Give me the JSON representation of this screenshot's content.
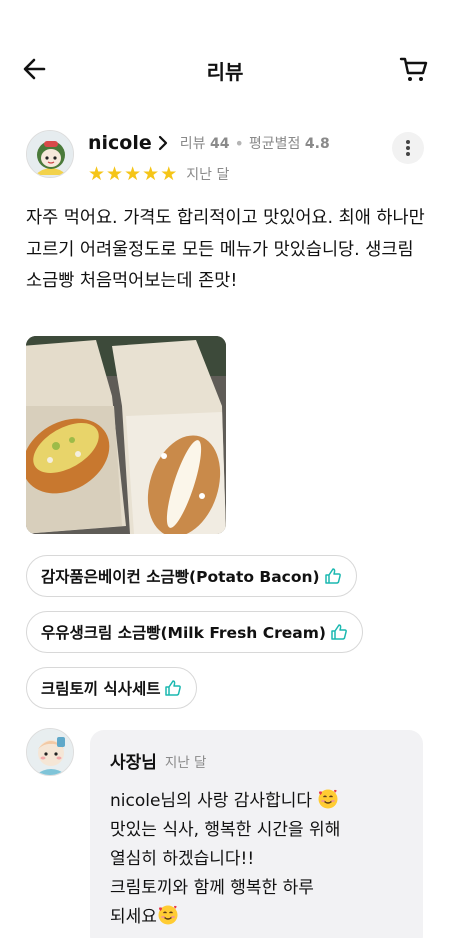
{
  "header": {
    "title": "리뷰",
    "back_icon": "arrow-left-icon",
    "cart_icon": "cart-icon"
  },
  "review": {
    "reviewer_name": "nicole",
    "review_count_label": "리뷰",
    "review_count": "44",
    "avg_rating_label": "평균별점",
    "avg_rating": "4.8",
    "stars": 5,
    "date": "지난 달",
    "text": "자주 먹어요. 가격도 합리적이고 맛있어요. 최애 하나만 고르기 어려울정도로 모든 메뉴가 맛있습니당. 생크림 소금빵 처음먹어보는데 존맛!",
    "photo_icon": "food-photo"
  },
  "menu_tags": [
    {
      "label": "감자품은베이컨 소금빵(Potato Bacon)",
      "icon": "thumbs-up-icon"
    },
    {
      "label": "우유생크림 소금빵(Milk Fresh Cream)",
      "icon": "thumbs-up-icon"
    },
    {
      "label": "크림토끼 식사세트",
      "icon": "thumbs-up-icon"
    }
  ],
  "owner_reply": {
    "name": "사장님",
    "date": "지난 달",
    "line1": "nicole님의 사랑 감사합니다",
    "line2": "맛있는 식사, 행복한 시간을 위해",
    "line3": "열심히 하겠습니다!!",
    "line4": "크림토끼와 함께 행복한 하루",
    "line5": "되세요",
    "emoji_icon": "smiling-face-with-hearts-icon"
  },
  "colors": {
    "star": "#f5c518",
    "thumb": "#1bb8b0",
    "bubble": "#f2f2f4",
    "meta": "#8a8a8a"
  }
}
